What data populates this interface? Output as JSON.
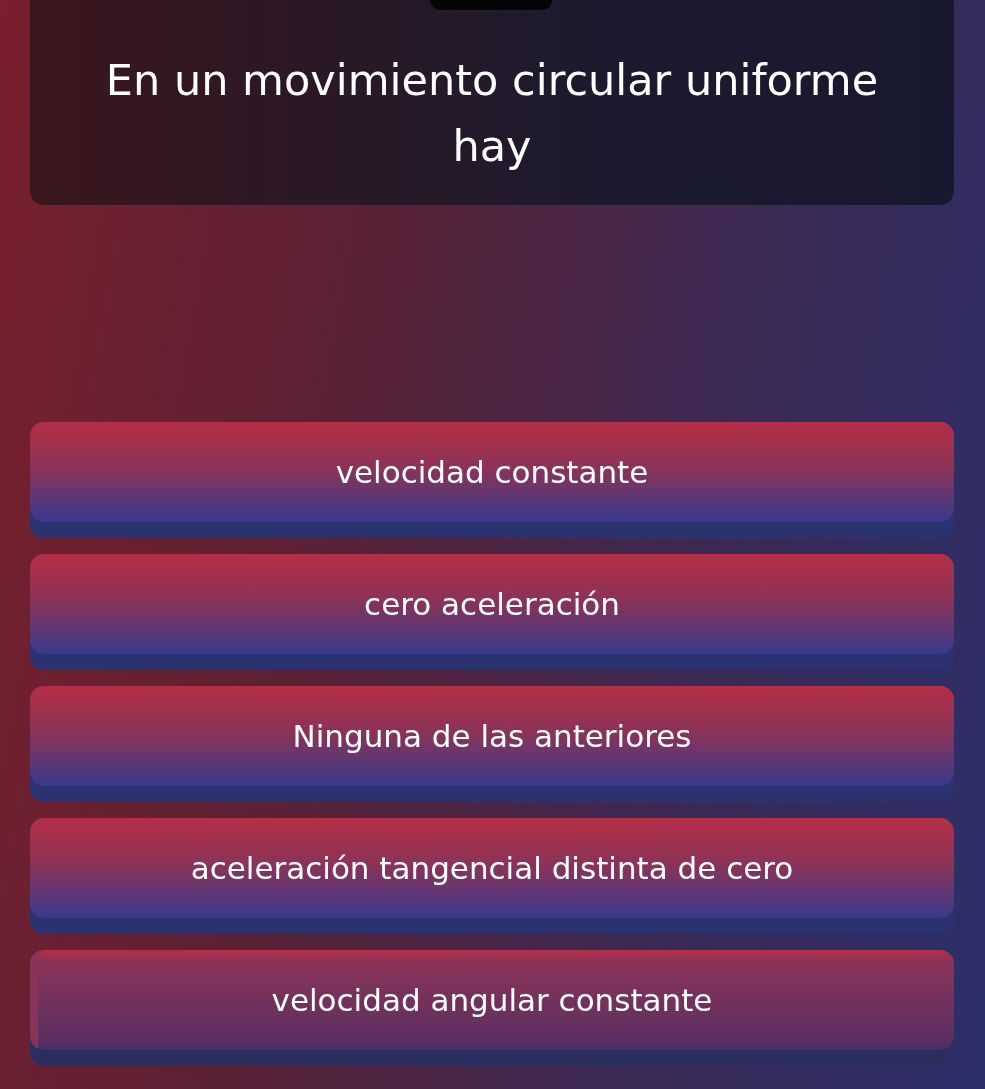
{
  "question": {
    "text": "En un movimiento circular uniforme hay"
  },
  "options": [
    {
      "label": "velocidad constante",
      "selected": false
    },
    {
      "label": "cero aceleración",
      "selected": false
    },
    {
      "label": "Ninguna de las anteriores",
      "selected": false
    },
    {
      "label": "aceleración tangencial distinta de cero",
      "selected": false
    },
    {
      "label": "velocidad angular constante",
      "selected": true
    }
  ]
}
